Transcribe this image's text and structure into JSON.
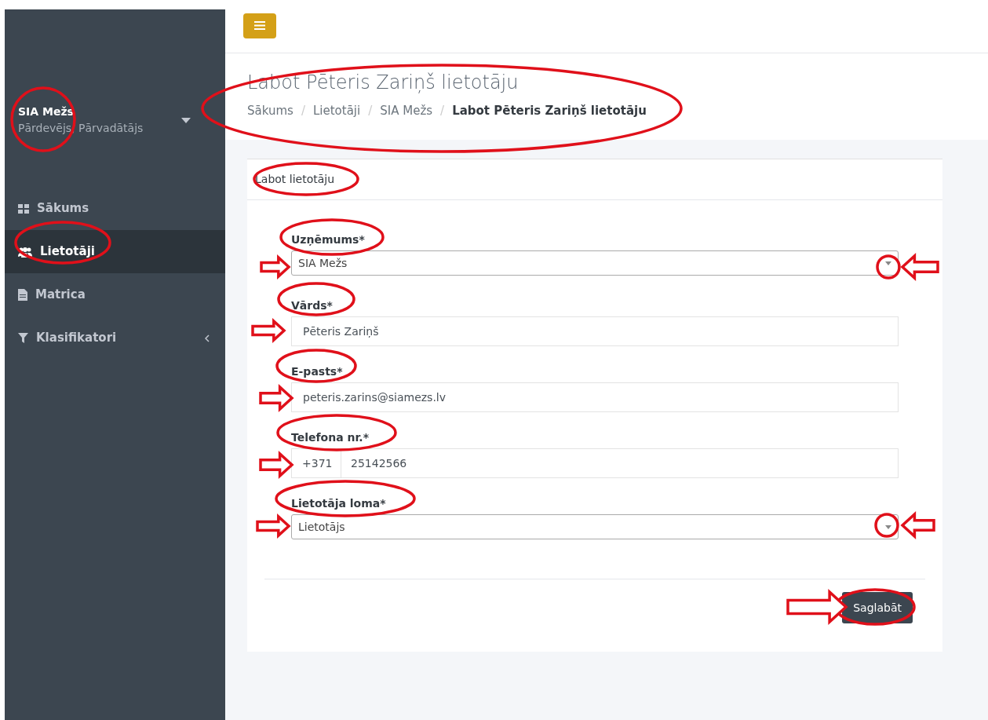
{
  "sidebar": {
    "company": "SIA Mežs",
    "roles": "Pārdevējs, Pārvadātājs",
    "items": [
      {
        "label": "Sākums",
        "selected": false,
        "has_submenu": false
      },
      {
        "label": "Lietotāji",
        "selected": true,
        "has_submenu": false
      },
      {
        "label": "Matrica",
        "selected": false,
        "has_submenu": false
      },
      {
        "label": "Klasifikatori",
        "selected": false,
        "has_submenu": true
      }
    ]
  },
  "header": {
    "title": "Labot Pēteris Zariņš lietotāju",
    "separators": [
      "/",
      "/",
      "/"
    ],
    "breadcrumb": [
      {
        "label": "Sākums",
        "current": false
      },
      {
        "label": "Lietotāji",
        "current": false
      },
      {
        "label": "SIA Mežs",
        "current": false
      },
      {
        "label": "Labot Pēteris Zariņš lietotāju",
        "current": true
      }
    ]
  },
  "card": {
    "title": "Labot lietotāju",
    "fields": [
      {
        "kind": "select",
        "label": "Uzņēmums*",
        "value": "SIA Mežs"
      },
      {
        "kind": "text",
        "label": "Vārds*",
        "value": "Pēteris Zariņš"
      },
      {
        "kind": "text",
        "label": "E-pasts*",
        "value": "peteris.zarins@siamezs.lv"
      },
      {
        "kind": "phone",
        "label": "Telefona nr.*",
        "prefix": "+371",
        "value": "25142566"
      },
      {
        "kind": "select",
        "label": "Lietotāja loma*",
        "value": "Lietotājs"
      }
    ],
    "save_button": "Saglabāt"
  }
}
